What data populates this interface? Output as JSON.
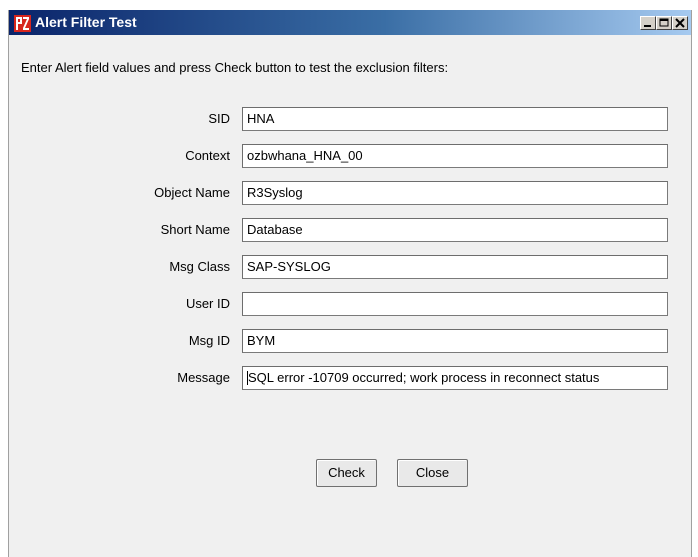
{
  "window": {
    "title": "Alert Filter Test",
    "controls": {
      "minimize": "minimize",
      "maximize": "maximize",
      "close": "close"
    }
  },
  "instruction": "Enter Alert field values and press Check button to test the exclusion filters:",
  "fields": [
    {
      "label": "SID",
      "value": "HNA"
    },
    {
      "label": "Context",
      "value": "ozbwhana_HNA_00"
    },
    {
      "label": "Object Name",
      "value": "R3Syslog"
    },
    {
      "label": "Short Name",
      "value": "Database"
    },
    {
      "label": "Msg Class",
      "value": "SAP-SYSLOG"
    },
    {
      "label": "User ID",
      "value": ""
    },
    {
      "label": "Msg ID",
      "value": "BYM"
    },
    {
      "label": "Message",
      "value": "SQL error -10709 occurred; work process in reconnect status"
    }
  ],
  "buttons": {
    "check": "Check",
    "close": "Close"
  },
  "icons": {
    "app": "pz-app-icon",
    "minimize": "minimize-icon",
    "maximize": "maximize-icon",
    "close": "close-icon"
  },
  "colors": {
    "titlebar_start": "#0a246a",
    "titlebar_end": "#a6caf0",
    "dialog_bg": "#f0f0f0"
  }
}
